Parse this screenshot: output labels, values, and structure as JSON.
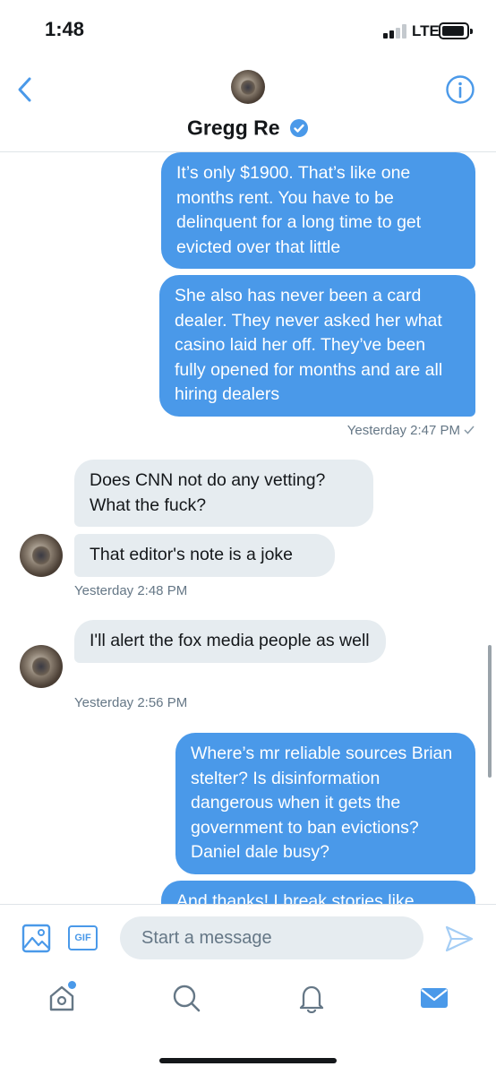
{
  "status_bar": {
    "time": "1:48",
    "network": "LTE",
    "signal_bars_active": 2,
    "signal_bars_total": 4
  },
  "header": {
    "back_icon": "chevron-left-icon",
    "info_icon": "info-circle-icon",
    "contact_name": "Gregg Re",
    "verified_icon": "verified-badge-icon"
  },
  "messages": [
    {
      "direction": "sent",
      "text": "It’s only $1900. That’s like one months rent. You have to be delinquent for a long time to get evicted over that little"
    },
    {
      "direction": "sent",
      "text": "She also has never been a card dealer. They never asked her what casino laid her off. They’ve been fully opened for months and are all hiring dealers",
      "timestamp": "Yesterday 2:47 PM",
      "read_icon": "checkmark-icon"
    },
    {
      "direction": "received",
      "text": "Does CNN not do any vetting? What the fuck?"
    },
    {
      "direction": "received",
      "text": "That editor's note is a joke",
      "timestamp": "Yesterday 2:48 PM"
    },
    {
      "direction": "received",
      "text": "I'll alert the fox media people as well",
      "timestamp": "Yesterday 2:56 PM"
    },
    {
      "direction": "sent",
      "text": "Where’s mr reliable sources Brian stelter? Is disinformation dangerous when it gets the government to ban evictions? Daniel dale busy?"
    },
    {
      "direction": "sent",
      "text": "And thanks! I break stories like"
    }
  ],
  "composer": {
    "image_icon": "image-icon",
    "gif_label": "GIF",
    "placeholder": "Start a message",
    "value": "",
    "send_icon": "send-icon"
  },
  "tab_bar": {
    "tabs": [
      "home-icon",
      "search-icon",
      "notifications-icon",
      "messages-icon"
    ],
    "active_tab": "messages-icon",
    "home_has_new": true
  },
  "colors": {
    "accent": "#4a99e9",
    "sent_bubble": "#4a99e9",
    "received_bubble": "#e6ecf0",
    "secondary_text": "#657786"
  }
}
